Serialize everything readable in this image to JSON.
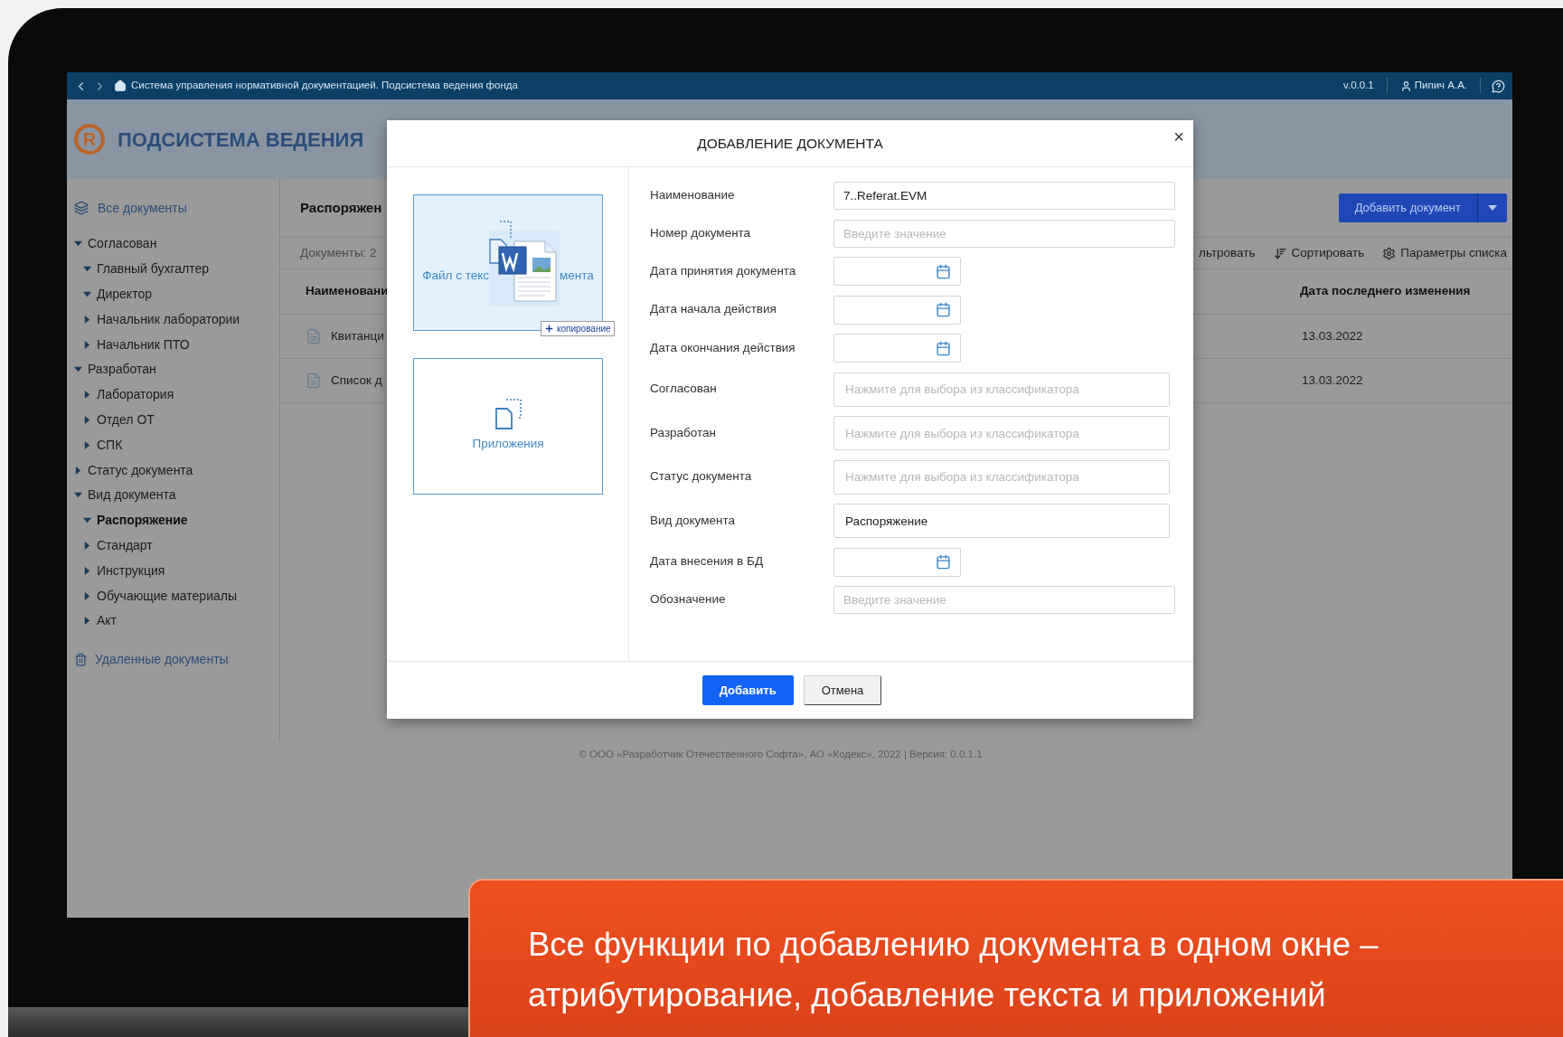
{
  "topbar": {
    "title": "Система управления нормативной документацией. Подсистема ведения фонда",
    "version": "v.0.0.1",
    "user": "Пипич А.А."
  },
  "header": {
    "logo_letter": "R",
    "title": "ПОДСИСТЕМА ВЕДЕНИЯ"
  },
  "sidebar": {
    "all_documents": "Все документы",
    "deleted": "Удаленные документы",
    "tree": [
      {
        "label": "Согласован",
        "expanded": true,
        "selected": false,
        "children": [
          {
            "label": "Главный бухгалтер",
            "expanded": true,
            "selected": false
          },
          {
            "label": "Директор",
            "expanded": true,
            "selected": false
          },
          {
            "label": "Начальник лаборатории",
            "expanded": false,
            "selected": false
          },
          {
            "label": "Начальник ПТО",
            "expanded": false,
            "selected": false
          }
        ]
      },
      {
        "label": "Разработан",
        "expanded": true,
        "selected": false,
        "children": [
          {
            "label": "Лаборатория",
            "expanded": false,
            "selected": false
          },
          {
            "label": "Отдел ОТ",
            "expanded": false,
            "selected": false
          },
          {
            "label": "СПК",
            "expanded": false,
            "selected": false
          }
        ]
      },
      {
        "label": "Статус документа",
        "expanded": false,
        "selected": false
      },
      {
        "label": "Вид документа",
        "expanded": true,
        "selected": false,
        "children": [
          {
            "label": "Распоряжение",
            "expanded": true,
            "selected": true
          },
          {
            "label": "Стандарт",
            "expanded": false,
            "selected": false
          },
          {
            "label": "Инструкция",
            "expanded": false,
            "selected": false
          },
          {
            "label": "Обучающие материалы",
            "expanded": false,
            "selected": false
          },
          {
            "label": "Акт",
            "expanded": false,
            "selected": false
          }
        ]
      }
    ]
  },
  "main": {
    "heading": "Распоряжен",
    "count": "Документы: 2",
    "add_button": "Добавить документ",
    "toolbar": [
      {
        "kind": "filter",
        "label": "льтровать"
      },
      {
        "kind": "sort",
        "label": "Сортировать"
      },
      {
        "kind": "settings",
        "label": "Параметры списка"
      }
    ],
    "columns": [
      "Наименовани",
      "Дата последнего изменения"
    ],
    "rows": [
      {
        "name": "Квитанци",
        "date": "13.03.2022"
      },
      {
        "name": "Список д",
        "date": "13.03.2022"
      }
    ]
  },
  "modal": {
    "title": "ДОБАВЛЕНИЕ ДОКУМЕНТА",
    "close": "×",
    "cards": [
      {
        "kind": "text_file",
        "label_start": "Файл с текс",
        "label_end": "мента",
        "badge": "копирование"
      },
      {
        "kind": "attachments",
        "label": "Приложения"
      }
    ],
    "fields": [
      {
        "kind": "text",
        "label": "Наименование",
        "value": "7..Referat.EVM"
      },
      {
        "kind": "text",
        "label": "Номер документа",
        "placeholder": "Введите значение"
      },
      {
        "kind": "date",
        "label": "Дата принятия документа"
      },
      {
        "kind": "date",
        "label": "Дата начала действия"
      },
      {
        "kind": "date",
        "label": "Дата окончания действия"
      },
      {
        "kind": "classifier",
        "label": "Согласован",
        "placeholder": "Нажмите для выбора из классификатора"
      },
      {
        "kind": "classifier",
        "label": "Разработан",
        "placeholder": "Нажмите для выбора из классификатора"
      },
      {
        "kind": "classifier",
        "label": "Статус документа",
        "placeholder": "Нажмите для выбора из классификатора"
      },
      {
        "kind": "classifier",
        "label": "Вид документа",
        "value": "Распоряжение"
      },
      {
        "kind": "date",
        "label": "Дата внесения в БД"
      },
      {
        "kind": "text",
        "label": "Обозначение",
        "placeholder": "Введите значение"
      }
    ],
    "buttons": [
      {
        "kind": "primary",
        "label": "Добавить"
      },
      {
        "kind": "secondary",
        "label": "Отмена"
      }
    ]
  },
  "footer": "© ООО «Разработчик Отечественного Софта», АО «Кодекс», 2022 | Версия: 0.0.1.1",
  "caption": [
    "Все функции по добавлению документа в одном окне –",
    "атрибутирование, добавление текста и приложений"
  ]
}
